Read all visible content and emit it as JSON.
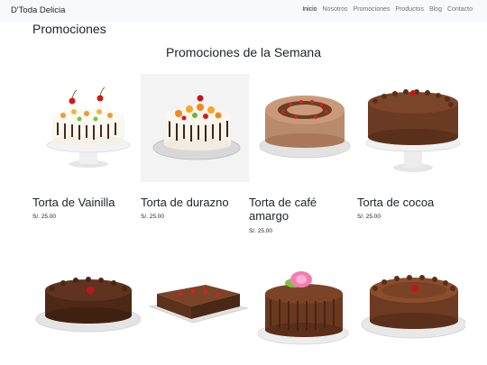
{
  "navbar": {
    "brand": "D'Toda Delicia",
    "links": [
      "Inicio",
      "Nosotros",
      "Promociones",
      "Productos",
      "Blog",
      "Contacto"
    ]
  },
  "page": {
    "title": "Promociones",
    "section_title": "Promociones de la Semana"
  },
  "products": [
    {
      "name": "Torta de Vainilla",
      "price": "S/. 25.00"
    },
    {
      "name": "Torta de durazno",
      "price": "S/. 25.00"
    },
    {
      "name": "Torta de café amargo",
      "price": "S/. 25.00"
    },
    {
      "name": "Torta de cocoa",
      "price": "S/. 25.00"
    }
  ],
  "colors": {
    "navbar_bg": "#f8f9fa",
    "text": "#212529",
    "nav_muted": "#6c757d"
  }
}
